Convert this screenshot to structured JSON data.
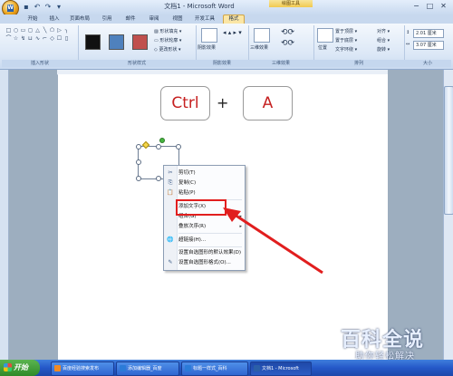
{
  "window": {
    "title": "文档1 - Microsoft Word",
    "context_tab_header": "绘图工具",
    "office_logo": "W",
    "qa_icons": [
      "save-icon",
      "undo-icon",
      "redo-icon",
      "dropdown-icon"
    ],
    "controls": [
      "−",
      "□",
      "✕"
    ]
  },
  "tabs": [
    "开始",
    "插入",
    "页面布局",
    "引用",
    "邮件",
    "审阅",
    "视图",
    "开发工具",
    "格式"
  ],
  "active_tab": "格式",
  "ribbon": {
    "groups": {
      "insert_shapes": "插入形状",
      "shape_styles": "形状样式",
      "shadow": "阴影效果",
      "threed": "三维效果",
      "arrange": "排列",
      "size": "大小"
    },
    "shape_glyphs": [
      "□",
      "○",
      "▭",
      "◻",
      "△",
      "╲",
      "⬠",
      "▷",
      "╮",
      "⌒",
      "☆",
      "↯",
      "⊔",
      "∿",
      "⌐",
      "◇",
      "☐",
      "▯"
    ],
    "shape_cmds": [
      "形状填充 ▾",
      "形状轮廓 ▾",
      "更改形状 ▾"
    ],
    "shadow_label": "阴影效果",
    "threed_label": "三维效果",
    "arrange_cmds": [
      "置于顶层 ▾",
      "置于底层 ▾",
      "文字环绕 ▾"
    ],
    "arrange_cmds2": [
      "对齐 ▾",
      "组合 ▾",
      "旋转 ▾"
    ],
    "position_label": "位置",
    "size_height": "2.01 厘米",
    "size_width": "3.07 厘米"
  },
  "swatch_colors": [
    "#111111",
    "#4f81bd",
    "#c0504d"
  ],
  "keys": [
    "Ctrl",
    "+",
    "A"
  ],
  "context_menu": [
    {
      "icon": "cut-icon",
      "glyph": "✂",
      "label": "剪切(T)"
    },
    {
      "icon": "copy-icon",
      "glyph": "⎘",
      "label": "复制(C)"
    },
    {
      "icon": "paste-icon",
      "glyph": "📋",
      "label": "粘贴(P)"
    },
    {
      "icon": "",
      "glyph": "",
      "label": "添加文字(X)"
    },
    {
      "icon": "",
      "glyph": "",
      "label": "组合(G)",
      "arrow": "▸"
    },
    {
      "icon": "",
      "glyph": "",
      "label": "叠放次序(R)",
      "arrow": "▸"
    },
    {
      "icon": "hyperlink-icon",
      "glyph": "🌐",
      "label": "超链接(H)..."
    },
    {
      "icon": "",
      "glyph": "",
      "label": "设置自选图形的默认效果(D)"
    },
    {
      "icon": "format-shape-icon",
      "glyph": "✎",
      "label": "设置自选图形格式(O)..."
    }
  ],
  "watermark": {
    "title": "百科全说",
    "subtitle": "助你轻松解决"
  },
  "taskbar": {
    "start": "开始",
    "items": [
      {
        "label": "百度经验搜索发布",
        "color": "#f08a24"
      },
      {
        "label": "添加编辑器_百度",
        "color": "#2b7bd8"
      },
      {
        "label": "标题一样式_百科",
        "color": "#2b7bd8"
      },
      {
        "label": "文档1 - Microsoft",
        "color": "#2b5fa8"
      }
    ]
  }
}
